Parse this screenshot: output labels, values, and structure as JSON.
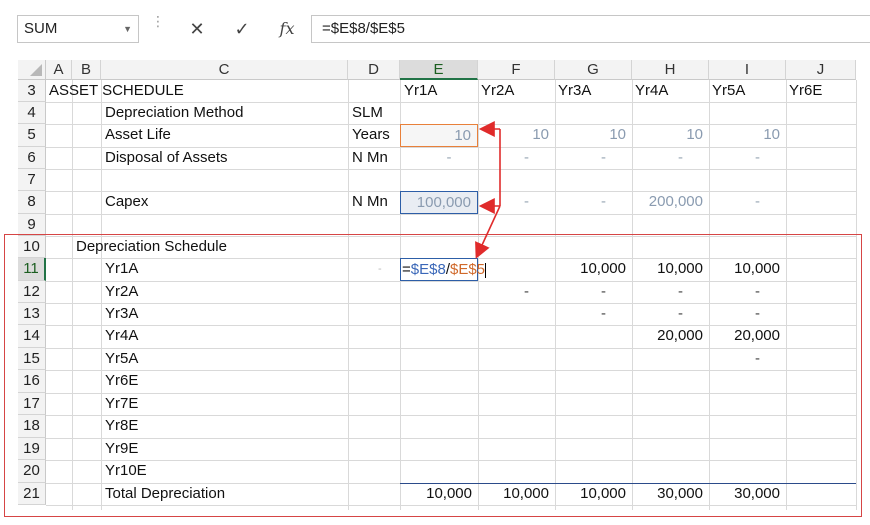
{
  "formula_bar": {
    "name_box": "SUM",
    "cancel_icon": "✕",
    "enter_icon": "✓",
    "fx_label": "fx",
    "formula": "=$E$8/$E$5"
  },
  "columns": [
    "A",
    "B",
    "C",
    "D",
    "E",
    "F",
    "G",
    "H",
    "I",
    "J"
  ],
  "rows": [
    "3",
    "4",
    "5",
    "6",
    "7",
    "8",
    "9",
    "10",
    "11",
    "12",
    "13",
    "14",
    "15",
    "16",
    "17",
    "18",
    "19",
    "20",
    "21"
  ],
  "sheet": {
    "title": "ASSET SCHEDULE",
    "years": [
      "Yr1A",
      "Yr2A",
      "Yr3A",
      "Yr4A",
      "Yr5A",
      "Yr6E"
    ],
    "dep_method_label": "Depreciation Method",
    "dep_method_value": "SLM",
    "asset_life_label": "Asset Life",
    "asset_life_unit": "Years",
    "asset_life": [
      "10",
      "10",
      "10",
      "10",
      "10"
    ],
    "disposal_label": "Disposal of Assets",
    "disposal_unit": "N Mn",
    "disposal": [
      "-",
      "-",
      "-",
      "-",
      "-"
    ],
    "capex_label": "Capex",
    "capex_unit": "N Mn",
    "capex": [
      "100,000",
      "-",
      "-",
      "200,000",
      "-"
    ],
    "dep_schedule_label": "Depreciation Schedule",
    "schedule_rows": [
      "Yr1A",
      "Yr2A",
      "Yr3A",
      "Yr4A",
      "Yr5A",
      "Yr6E",
      "Yr7E",
      "Yr8E",
      "Yr9E",
      "Yr10E"
    ],
    "edit_formula_prefix": "=",
    "edit_ref1": "$E$8",
    "edit_slash": "/",
    "edit_ref2": "$E$5",
    "r11": {
      "D": "-",
      "G": "10,000",
      "H": "10,000",
      "I": "10,000"
    },
    "r12": {
      "F": "-",
      "G": "-",
      "H": "-",
      "I": "-"
    },
    "r13": {
      "G": "-",
      "H": "-",
      "I": "-"
    },
    "r14": {
      "H": "20,000",
      "I": "20,000"
    },
    "r15": {
      "I": "-"
    },
    "total_label": "Total Depreciation",
    "totals": [
      "10,000",
      "10,000",
      "10,000",
      "30,000",
      "30,000"
    ]
  },
  "colors": {
    "ref1": "#3a67b8",
    "ref2": "#d0692a",
    "highlight_box": "#d64545",
    "excel_green": "#217346"
  }
}
